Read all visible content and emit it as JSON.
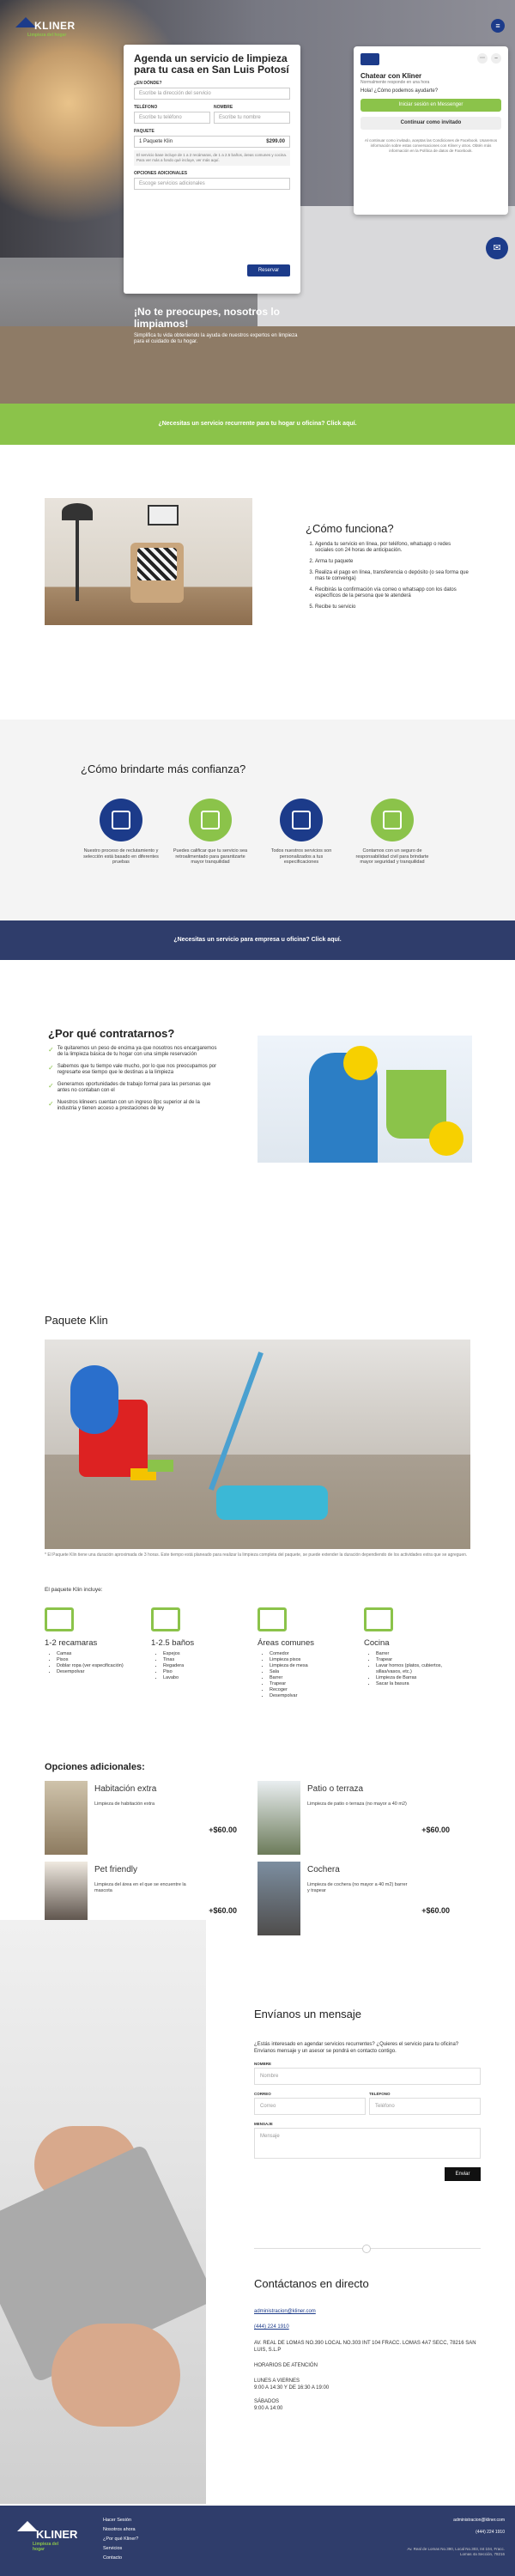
{
  "brand": {
    "name": "KLINER",
    "tagline": "Limpieza del hogar"
  },
  "booking": {
    "title": "Agenda un servicio de limpieza para tu casa en San Luis Potosí",
    "where_label": "¿EN DÓNDE?",
    "where_placeholder": "Escribe la dirección del servicio",
    "phone_label": "TELÉFONO",
    "phone_placeholder": "Escribe tu teléfono",
    "name_label": "NOMBRE",
    "name_placeholder": "Escribe tu nombre",
    "package_label": "PAQUETE",
    "package_value": "1 Paquete Klin",
    "package_price": "$299.00",
    "package_note": "El servicio base incluye de 1 a 2 recámaras, de 1 a 2.5 baños, áreas comunes y cocina. Para ver más a fondo qué incluye, ver más aquí.",
    "extras_label": "OPCIONES ADICIONALES",
    "extras_placeholder": "Escoge servicios adicionales",
    "reserve": "Reservar"
  },
  "hero": {
    "headline": "¡No te preocupes, nosotros lo limpiamos!",
    "sub": "Simplifica tu vida obteniendo la ayuda de nuestros expertos en limpieza para el cuidado de tu hogar."
  },
  "chat": {
    "title": "Chatear con Kliner",
    "subtitle": "Normalmente responde en una hora",
    "greeting": "Hola! ¿Cómo podemos ayudarte?",
    "messenger": "Iniciar sesión en Messenger",
    "guest": "Continuar como invitado",
    "legal": "Al continuar como invitado, aceptas las Condiciones de Facebook. Usaremos información sobre estas conversaciones con Kliner y otros. Obtén más información en la Política de datos de Facebook."
  },
  "band_green": "¿Necesitas un servicio recurrente para tu hogar u oficina? Click aquí.",
  "como": {
    "title": "¿Cómo funciona?",
    "steps": [
      "Agenda tu servicio en línea, por teléfono, whatsapp o redes sociales con 24 horas de anticipación.",
      "Arma tu paquete",
      "Realiza el pago en línea, transferencia o depósito (o sea forma que mas te convenga)",
      "Recibirás la confirmación vía correo o whatsapp con los datos específicos de la persona que te atenderá",
      "Recibe tu servicio"
    ]
  },
  "confianza": {
    "title": "¿Cómo brindarte más confianza?",
    "items": [
      {
        "text": "Nuestro proceso de reclutamiento y selección está basado en diferentes pruebas",
        "color": "#1c3b8a"
      },
      {
        "text": "Puedes calificar que tu servicio sea retroalimentado para garantizarte mayor tranquilidad",
        "color": "#8bc34a"
      },
      {
        "text": "Todos nuestros servicios son personalizados a tus especificaciones",
        "color": "#1c3b8a"
      },
      {
        "text": "Contamos con un seguro de responsabilidad civil para brindarte mayor seguridad y tranquilidad",
        "color": "#8bc34a"
      }
    ]
  },
  "band_blue": "¿Necesitas un servicio para empresa u oficina? Click aquí.",
  "porque": {
    "title": "¿Por qué contratarnos?",
    "items": [
      "Te quitaremos un peso de encima ya que nosotros nos encargaremos de la limpieza básica de tu hogar con una simple reservación",
      "Sabemos que tu tiempo vale mucho, por lo que nos preocupamos por regresarte ese tiempo que le destinas a la limpieza",
      "Generamos oportunidades de trabajo formal para las personas que antes no contaban con el",
      "Nuestros klineers cuentan con un ingreso 8pc superior al de la industria y tienen acceso a prestaciones de ley"
    ]
  },
  "paquete": {
    "title": "Paquete Klin",
    "note": "* El Paquete Klin tiene una duración aproximada de 3 horas. Este tiempo está planeado para realizar la limpieza completa del paquete, se puede extender la duración dependiendo de los actividades extra que se agreguen.",
    "includes": "El paquete Klin incluye:",
    "cols": [
      {
        "title": "1-2 recamaras",
        "items": [
          "Camas",
          "Pisos",
          "Doblar ropa (ver especificación)",
          "Desempolvar"
        ]
      },
      {
        "title": "1-2.5 baños",
        "items": [
          "Espejos",
          "Tinas",
          "Regadera",
          "Piso",
          "Lavabo"
        ]
      },
      {
        "title": "Áreas comunes",
        "items": [
          "Comedor",
          "Limpieza pisos",
          "Limpieza de mesa",
          "Sala",
          "Barrer",
          "Trapear",
          "Recoger",
          "Desempolvar"
        ]
      },
      {
        "title": "Cocina",
        "items": [
          "Barrer",
          "Trapear",
          "Lavar hornos (platos, cubiertos, sillas/vasos, etc.)",
          "Limpieza de Barras",
          "Sacar la basura"
        ]
      }
    ]
  },
  "opciones": {
    "title": "Opciones adicionales:",
    "items": [
      {
        "title": "Habitación extra",
        "desc": "Limpieza de habitación extra",
        "price": "+$60.00"
      },
      {
        "title": "Patio o terraza",
        "desc": "Limpieza de patio o terraza (no mayor a 40 m2)",
        "price": "+$60.00"
      },
      {
        "title": "Pet friendly",
        "desc": "Limpieza del área en el que se encuentre la mascota",
        "price": "+$60.00"
      },
      {
        "title": "Cochera",
        "desc": "Limpieza de cochera (no mayor a 40 m2) barrer y trapear",
        "price": "+$60.00"
      }
    ]
  },
  "contact_form": {
    "title": "Envíanos un mensaje",
    "intro": "¿Estás interesado en agendar servicios recurrentes? ¿Quieres el servicio para tu oficina? Envíanos mensaje y un asesor se pondrá en contacto contigo.",
    "name_label": "NOMBRE",
    "name_placeholder": "Nombre",
    "email_label": "CORREO",
    "email_placeholder": "Correo",
    "phone_label": "TELÉFONO",
    "phone_placeholder": "Teléfono",
    "message_label": "MENSAJE",
    "message_placeholder": "Mensaje",
    "send": "Enviar"
  },
  "contact": {
    "title": "Contáctanos en directo",
    "email": "administracion@kliner.com",
    "phone": "(444) 224 1910",
    "address": "AV. REAL DE LOMAS NO.390 LOCAL NO.303 INT 104 FRACC. LOMAS 4A7 SECC, 78216 SAN LUIS, S.L.P",
    "hours_title": "HORARIOS DE ATENCIÓN",
    "weekday": "LUNES A VIERNES",
    "weekday_hours": "9:00 A 14:30 Y DE 16:30 A 19:00",
    "sat": "SÁBADOS",
    "sat_hours": "9:00 A 14:00"
  },
  "footer": {
    "links": [
      "Hacer Sesión",
      "Nosotros ahora",
      "¿Por qué Kliner?",
      "Servicios",
      "Contacto"
    ],
    "email": "administracion@kliner.com",
    "phone": "(444) 224 1910",
    "address": "Av. Real de Lomas No.390, Local No.303, Int 104, Fracc. Lomas 4a Sección, 78216"
  }
}
